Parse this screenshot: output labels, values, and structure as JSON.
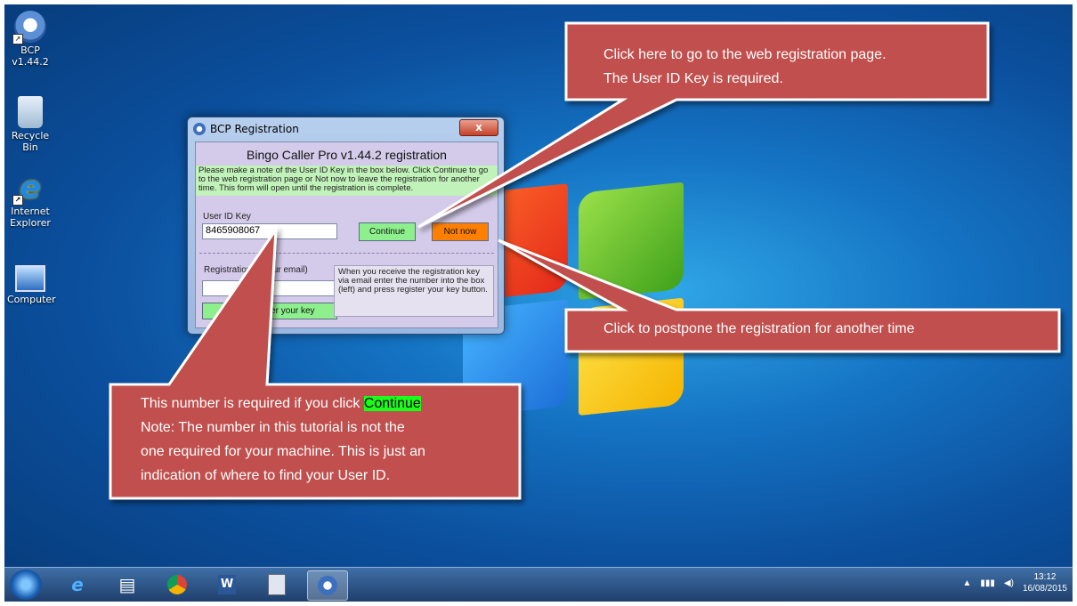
{
  "desktop_icons": [
    {
      "label": "BCP v1.44.2",
      "icon": "bcp-icon"
    },
    {
      "label": "Recycle Bin",
      "icon": "recycle-bin-icon"
    },
    {
      "label": "Internet Explorer",
      "icon": "internet-explorer-icon"
    },
    {
      "label": "Computer",
      "icon": "computer-icon"
    }
  ],
  "dialog": {
    "title": "BCP Registration",
    "close_label": "x",
    "heading": "Bingo Caller Pro v1.44.2 registration",
    "note": "Please make a note of the User ID Key in the box below. Click Continue to go to the web registration page or Not now to leave the registration for another time. This form will open until the registration is complete.",
    "user_id_label": "User ID Key",
    "user_id_value": "8465908067",
    "continue_label": "Continue",
    "not_now_label": "Not now",
    "registration_label": "Registration  n your email)",
    "registration_value": "",
    "register_button_label": "C                er your key",
    "info_text": "When you receive the registration key via email enter the number into the box (left) and press register your key button."
  },
  "callouts": {
    "top_right_line1": "Click here to go to the web registration page.",
    "top_right_line2": "The User ID Key is required.",
    "right": "Click to postpone the registration for another time",
    "bottom_line1_prefix": "This number is required if you click ",
    "bottom_line1_highlight": "Continue",
    "bottom_line2": "Note: The number in this tutorial is not the",
    "bottom_line3": "one required for your machine. This is just an",
    "bottom_line4": "indication of where to find your User ID."
  },
  "taskbar": {
    "items": [
      "start-button",
      "internet-explorer",
      "windows-explorer",
      "chrome",
      "word",
      "calculator",
      "bcp"
    ],
    "time": "13:12",
    "date": "16/08/2015"
  },
  "colors": {
    "callout_fill": "#c0504d",
    "highlight": "#1aff1a",
    "continue_button": "#8df08d",
    "not_now_button": "#ff7f00"
  }
}
